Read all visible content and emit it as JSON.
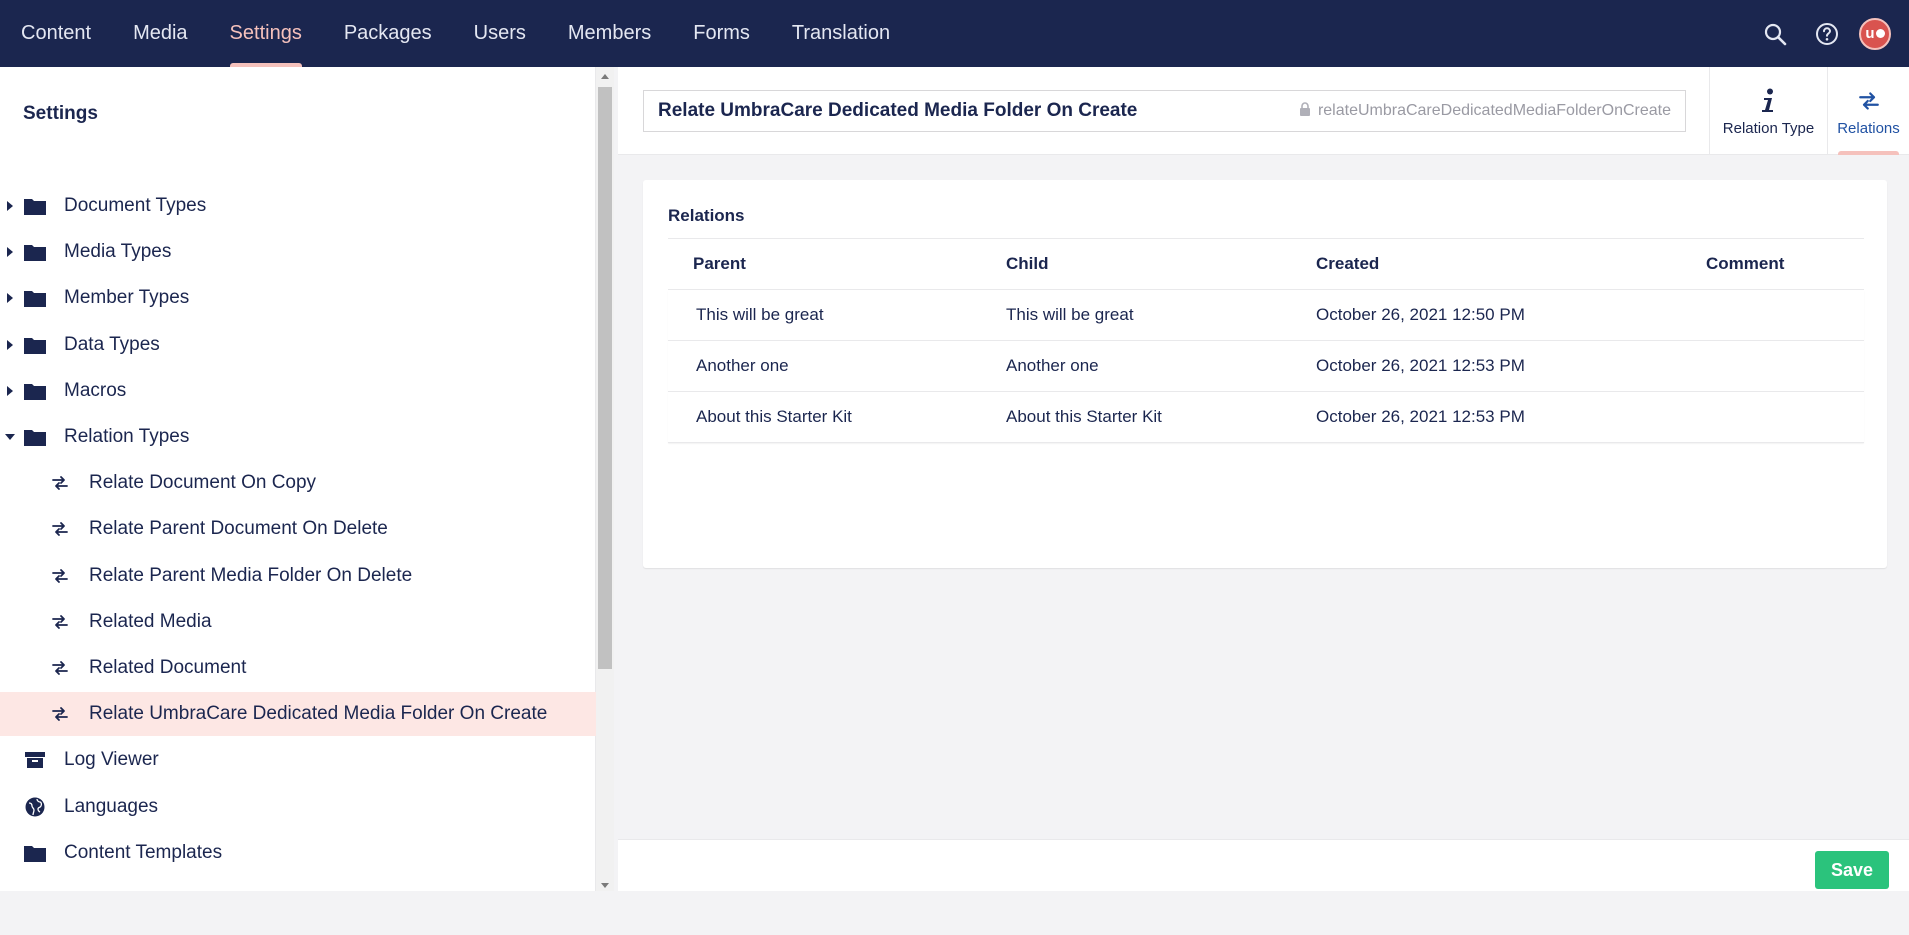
{
  "topbar": {
    "sections": [
      "Content",
      "Media",
      "Settings",
      "Packages",
      "Users",
      "Members",
      "Forms",
      "Translation"
    ],
    "active_section": "Settings",
    "avatar_initials": "u"
  },
  "sidebar": {
    "title": "Settings",
    "items": [
      {
        "label": "Document Types",
        "icon": "folder-icon",
        "level": 0,
        "caret": "right"
      },
      {
        "label": "Media Types",
        "icon": "folder-icon",
        "level": 0,
        "caret": "right"
      },
      {
        "label": "Member Types",
        "icon": "folder-icon",
        "level": 0,
        "caret": "right"
      },
      {
        "label": "Data Types",
        "icon": "folder-icon",
        "level": 0,
        "caret": "right"
      },
      {
        "label": "Macros",
        "icon": "folder-icon",
        "level": 0,
        "caret": "right"
      },
      {
        "label": "Relation Types",
        "icon": "folder-icon",
        "level": 0,
        "caret": "down"
      },
      {
        "label": "Relate Document On Copy",
        "icon": "exchange-icon",
        "level": 1
      },
      {
        "label": "Relate Parent Document On Delete",
        "icon": "exchange-icon",
        "level": 1
      },
      {
        "label": "Relate Parent Media Folder On Delete",
        "icon": "exchange-icon",
        "level": 1
      },
      {
        "label": "Related Media",
        "icon": "exchange-icon",
        "level": 1
      },
      {
        "label": "Related Document",
        "icon": "exchange-icon",
        "level": 1
      },
      {
        "label": "Relate UmbraCare Dedicated Media Folder On Create",
        "icon": "exchange-icon",
        "level": 1,
        "selected": true
      },
      {
        "label": "Log Viewer",
        "icon": "archive-icon",
        "level": 0
      },
      {
        "label": "Languages",
        "icon": "globe-icon",
        "level": 0
      },
      {
        "label": "Content Templates",
        "icon": "folder-icon",
        "level": 0
      }
    ]
  },
  "editor": {
    "name": "Relate UmbraCare Dedicated Media Folder On Create",
    "alias": "relateUmbraCareDedicatedMediaFolderOnCreate",
    "apps": [
      {
        "label": "Relation Type",
        "icon": "info-icon"
      },
      {
        "label": "Relations",
        "icon": "exchange-icon",
        "active": true
      }
    ]
  },
  "relations": {
    "title": "Relations",
    "columns": [
      "Parent",
      "Child",
      "Created",
      "Comment"
    ],
    "rows": [
      {
        "parent": "This will be great",
        "child": "This will be great",
        "created": "October 26, 2021 12:50 PM",
        "comment": ""
      },
      {
        "parent": "Another one",
        "child": "Another one",
        "created": "October 26, 2021 12:53 PM",
        "comment": ""
      },
      {
        "parent": "About this Starter Kit",
        "child": "About this Starter Kit",
        "created": "October 26, 2021 12:53 PM",
        "comment": ""
      }
    ]
  },
  "footer": {
    "save_label": "Save"
  },
  "colors": {
    "nav_bg": "#1b264f",
    "accent": "#f5c1bc",
    "selected_bg": "#fde7e4",
    "save_green": "#2bc37c"
  }
}
